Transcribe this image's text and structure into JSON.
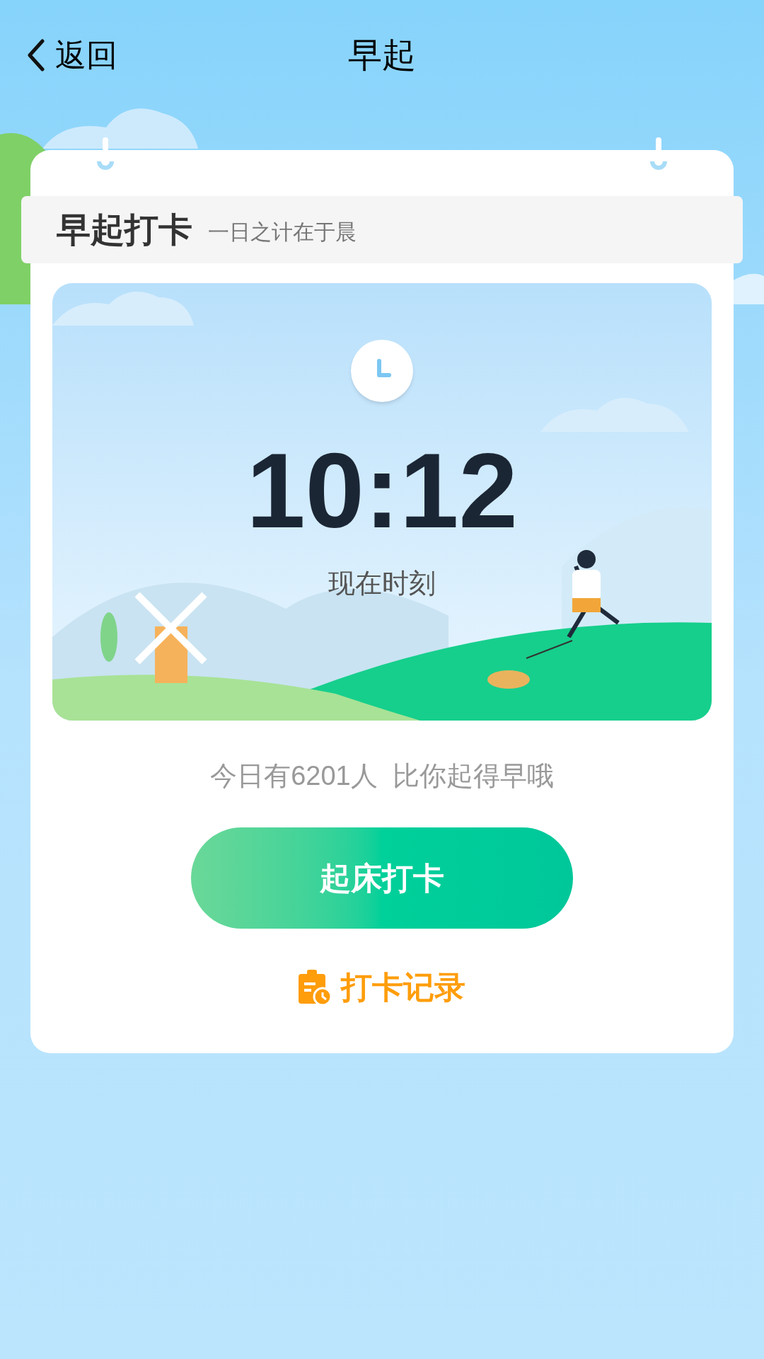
{
  "nav": {
    "back_label": "返回",
    "title": "早起"
  },
  "card": {
    "title": "早起打卡",
    "subtitle": "一日之计在于晨"
  },
  "clock": {
    "time": "10:12",
    "caption": "现在时刻"
  },
  "stat": "今日有6201人  比你起得早哦",
  "primary_button": "起床打卡",
  "record_link": "打卡记录"
}
